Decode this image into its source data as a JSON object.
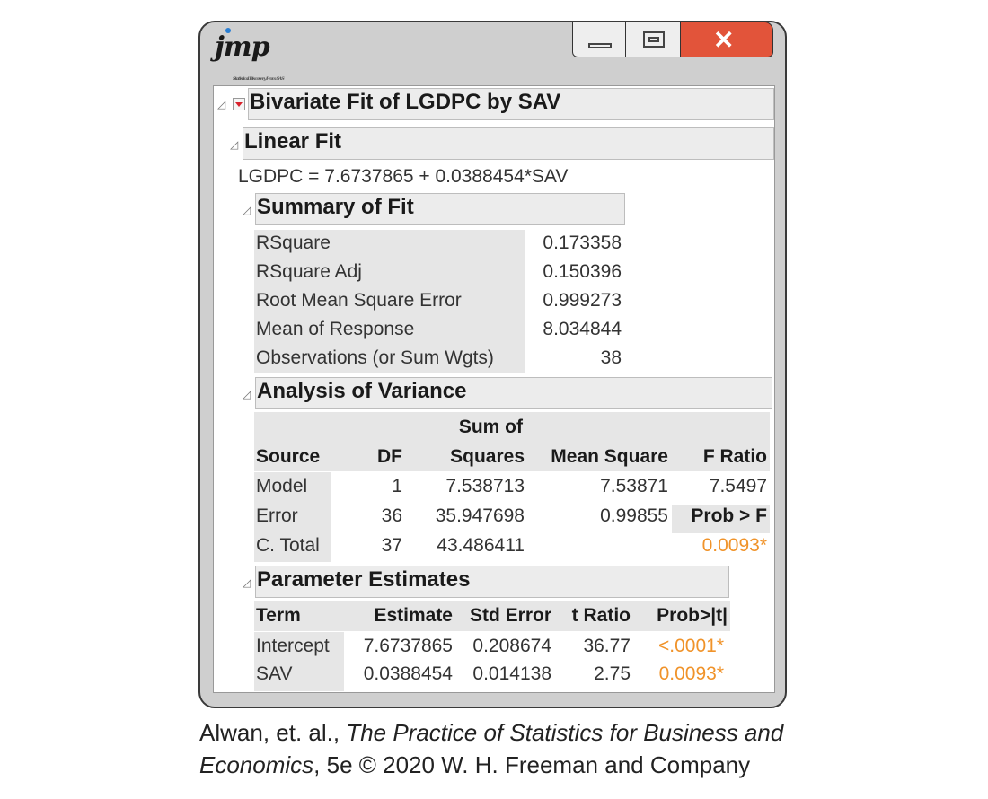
{
  "window": {
    "logo": "jmp",
    "logo_tagline": "Statistical Discovery From SAS",
    "controls": {
      "minimize": "minimize",
      "maximize": "maximize",
      "close": "close"
    }
  },
  "report": {
    "title": "Bivariate Fit of LGDPC by SAV",
    "linear_fit": {
      "title": "Linear Fit",
      "equation": "LGDPC = 7.6737865 + 0.0388454*SAV"
    },
    "summary_of_fit": {
      "title": "Summary of Fit",
      "rows": [
        {
          "label": "RSquare",
          "value": "0.173358"
        },
        {
          "label": "RSquare Adj",
          "value": "0.150396"
        },
        {
          "label": "Root Mean Square Error",
          "value": "0.999273"
        },
        {
          "label": "Mean of Response",
          "value": "8.034844"
        },
        {
          "label": "Observations (or Sum Wgts)",
          "value": "38"
        }
      ]
    },
    "anova": {
      "title": "Analysis of Variance",
      "headers": {
        "source": "Source",
        "df": "DF",
        "ss_top": "Sum of",
        "ss": "Squares",
        "ms": "Mean Square",
        "f": "F Ratio"
      },
      "rows": [
        {
          "source": "Model",
          "df": "1",
          "ss": "7.538713",
          "ms": "7.53871",
          "f": "7.5497"
        },
        {
          "source": "Error",
          "df": "36",
          "ss": "35.947698",
          "ms": "0.99855",
          "f": "Prob > F"
        },
        {
          "source": "C. Total",
          "df": "37",
          "ss": "43.486411",
          "ms": "",
          "f": "0.0093*"
        }
      ]
    },
    "parameter_estimates": {
      "title": "Parameter Estimates",
      "headers": {
        "term": "Term",
        "estimate": "Estimate",
        "se": "Std Error",
        "t": "t Ratio",
        "p": "Prob>|t|"
      },
      "rows": [
        {
          "term": "Intercept",
          "estimate": "7.6737865",
          "se": "0.208674",
          "t": "36.77",
          "p": "<.0001*"
        },
        {
          "term": "SAV",
          "estimate": "0.0388454",
          "se": "0.014138",
          "t": "2.75",
          "p": "0.0093*"
        }
      ]
    }
  },
  "caption": {
    "line1_prefix": "Alwan, et. al., ",
    "line1_title": "The Practice of Statistics for Business and",
    "line2_title": "Economics",
    "line2_rest": ", 5e © 2020 W. H. Freeman and Company"
  },
  "colors": {
    "significant": "#f0932a",
    "close_button": "#e2543a",
    "disclosure_red": "#d8212b"
  }
}
